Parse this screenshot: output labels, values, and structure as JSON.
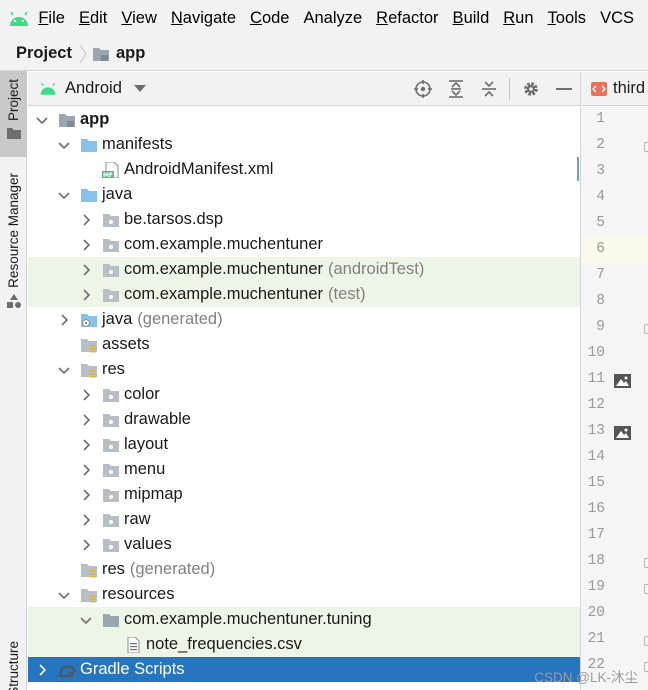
{
  "menu": {
    "items": [
      {
        "mnemonic": "F",
        "rest": "ile"
      },
      {
        "mnemonic": "E",
        "rest": "dit"
      },
      {
        "mnemonic": "V",
        "rest": "iew"
      },
      {
        "mnemonic": "N",
        "rest": "avigate"
      },
      {
        "mnemonic": "C",
        "rest": "ode"
      },
      {
        "mnemonic": "",
        "rest": "Analyze"
      },
      {
        "mnemonic": "R",
        "rest": "efactor"
      },
      {
        "mnemonic": "B",
        "rest": "uild"
      },
      {
        "mnemonic": "R",
        "rest": "un"
      },
      {
        "mnemonic": "T",
        "rest": "ools"
      },
      {
        "mnemonic": "",
        "rest": "VCS"
      }
    ]
  },
  "breadcrumb": {
    "project": "Project",
    "module": "app"
  },
  "sidebar": {
    "project_tab": "Project",
    "resource_manager_tab": "Resource Manager",
    "structure_tab": "Structure"
  },
  "project_view": {
    "view_mode": "Android",
    "tree": [
      {
        "label": "app",
        "suffix": ""
      },
      {
        "label": "manifests",
        "suffix": ""
      },
      {
        "label": "AndroidManifest.xml",
        "suffix": ""
      },
      {
        "label": "java",
        "suffix": ""
      },
      {
        "label": "be.tarsos.dsp",
        "suffix": ""
      },
      {
        "label": "com.example.muchentuner",
        "suffix": ""
      },
      {
        "label": "com.example.muchentuner",
        "suffix": "(androidTest)"
      },
      {
        "label": "com.example.muchentuner",
        "suffix": "(test)"
      },
      {
        "label": "java",
        "suffix": "(generated)"
      },
      {
        "label": "assets",
        "suffix": ""
      },
      {
        "label": "res",
        "suffix": ""
      },
      {
        "label": "color",
        "suffix": ""
      },
      {
        "label": "drawable",
        "suffix": ""
      },
      {
        "label": "layout",
        "suffix": ""
      },
      {
        "label": "menu",
        "suffix": ""
      },
      {
        "label": "mipmap",
        "suffix": ""
      },
      {
        "label": "raw",
        "suffix": ""
      },
      {
        "label": "values",
        "suffix": ""
      },
      {
        "label": "res",
        "suffix": "(generated)"
      },
      {
        "label": "resources",
        "suffix": ""
      },
      {
        "label": "com.example.muchentuner.tuning",
        "suffix": ""
      },
      {
        "label": "note_frequencies.csv",
        "suffix": ""
      },
      {
        "label": "Gradle Scripts",
        "suffix": ""
      }
    ]
  },
  "editor": {
    "tab_label": "third",
    "line_numbers": [
      "1",
      "2",
      "3",
      "4",
      "5",
      "6",
      "7",
      "8",
      "9",
      "10",
      "11",
      "12",
      "13",
      "14",
      "15",
      "16",
      "17",
      "18",
      "19",
      "20",
      "21",
      "22"
    ]
  },
  "watermark": "CSDN @LK-沐尘",
  "colors": {
    "android_green": "#3ddc84",
    "selection": "#2675bf",
    "test_row": "#edf6e6",
    "folder_blue": "#87c2ea"
  }
}
